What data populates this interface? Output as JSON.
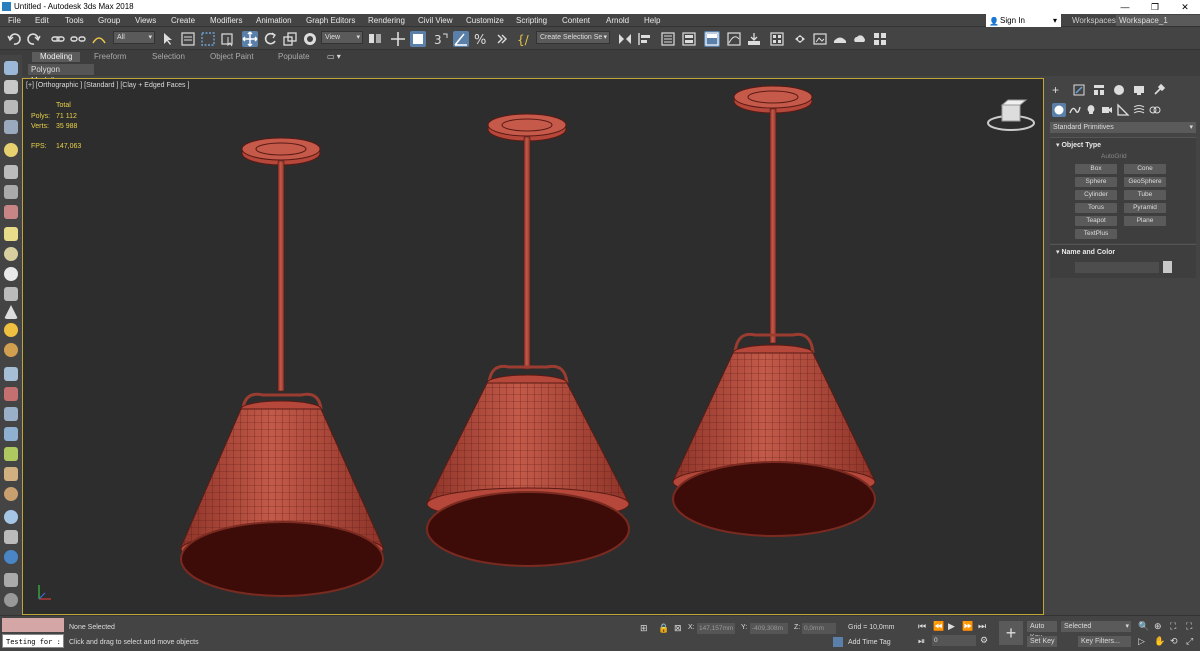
{
  "titlebar": {
    "title": "Untitled - Autodesk 3ds Max 2018",
    "minimize": "—",
    "maximize": "❐",
    "close": "✕"
  },
  "menubar": {
    "items": [
      "File",
      "Edit",
      "Tools",
      "Group",
      "Views",
      "Create",
      "Modifiers",
      "Animation",
      "Graph Editors",
      "Rendering",
      "Civil View",
      "Customize",
      "Scripting",
      "Content",
      "Arnold",
      "Help"
    ],
    "signin": "Sign In",
    "workspaces_label": "Workspaces:",
    "workspace_value": "Workspace_1"
  },
  "toolbar": {
    "filter_value": "All",
    "ref_coord": "View",
    "selection_set": "Create Selection Se"
  },
  "ribbon": {
    "tabs": [
      "Modeling",
      "Freeform",
      "Selection",
      "Object Paint",
      "Populate"
    ],
    "active": "Modeling",
    "sub": "Polygon Modeling"
  },
  "viewport": {
    "label": "[+] [Orthographic ] [Standard ] [Clay + Edged Faces ]",
    "stats": {
      "total_label": "Total",
      "polys_label": "Polys:",
      "polys": "71 112",
      "verts_label": "Verts:",
      "verts": "35 988",
      "fps_label": "FPS:",
      "fps": "147,063"
    }
  },
  "command_panel": {
    "dropdown": "Standard Primitives",
    "object_type_title": "Object Type",
    "autogrid": "AutoGrid",
    "buttons": [
      "Box",
      "Cone",
      "Sphere",
      "GeoSphere",
      "Cylinder",
      "Tube",
      "Torus",
      "Pyramid",
      "Teapot",
      "Plane",
      "TextPlus"
    ],
    "name_color_title": "Name and Color"
  },
  "status": {
    "listener": "Testing for :",
    "selected": "None Selected",
    "prompt": "Click and drag to select and move objects",
    "x_label": "X:",
    "x": "147,157mm",
    "y_label": "Y:",
    "y": "-409,308m",
    "z_label": "Z:",
    "z": "0,0mm",
    "grid": "Grid = 10,0mm",
    "add_time_tag": "Add Time Tag",
    "frame": "0",
    "auto_key": "Auto Key",
    "set_key": "Set Key",
    "selected_dropdown": "Selected",
    "key_filters": "Key Filters..."
  },
  "colors": {
    "accent_active": "#5a7fa8",
    "viewport_border": "#c0a63a",
    "lamp_fill": "#b5483a",
    "lamp_wire": "#5a1a14",
    "stats_yellow": "#e8d24a"
  }
}
